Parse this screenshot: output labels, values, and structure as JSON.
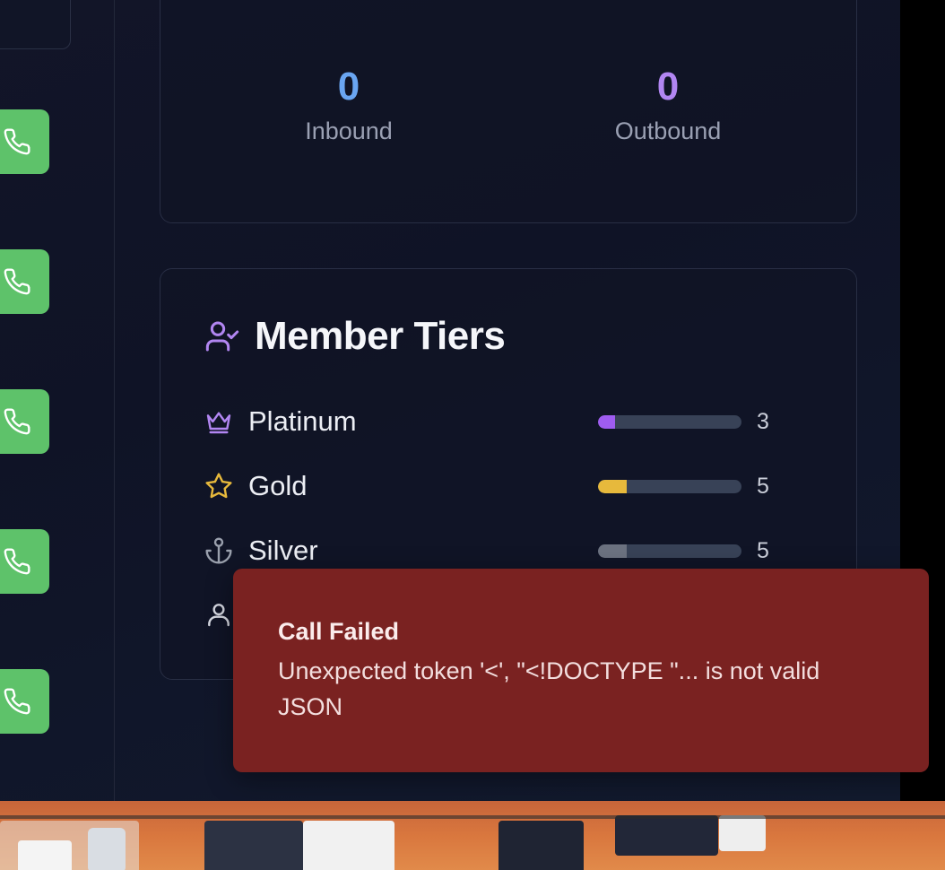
{
  "stats": {
    "inbound": {
      "value": "0",
      "label": "Inbound",
      "color": "#6aa6f2"
    },
    "outbound": {
      "value": "0",
      "label": "Outbound",
      "color": "#b286f2"
    }
  },
  "call_buttons": [
    {
      "icon": "phone-icon"
    },
    {
      "icon": "phone-icon"
    },
    {
      "icon": "phone-icon"
    },
    {
      "icon": "phone-icon"
    },
    {
      "icon": "phone-icon"
    }
  ],
  "member_tiers": {
    "title": "Member Tiers",
    "icon": "user-check-icon",
    "tiers": [
      {
        "name": "Platinum",
        "icon": "crown-icon",
        "count": "3",
        "fraction": 0.12,
        "color": "#9f5cf0"
      },
      {
        "name": "Gold",
        "icon": "star-icon",
        "count": "5",
        "fraction": 0.2,
        "color": "#e7b93c"
      },
      {
        "name": "Silver",
        "icon": "anchor-icon",
        "count": "5",
        "fraction": 0.2,
        "color": "#6c7280"
      }
    ],
    "hidden_tier_icon": "user-icon"
  },
  "toast": {
    "title": "Call Failed",
    "message": "Unexpected token '<', \"<!DOCTYPE \"... is not valid JSON",
    "color": "#7a2221"
  },
  "colors": {
    "call_button": "#5ec26a",
    "background": "#111527",
    "dock": "#d9773e"
  }
}
